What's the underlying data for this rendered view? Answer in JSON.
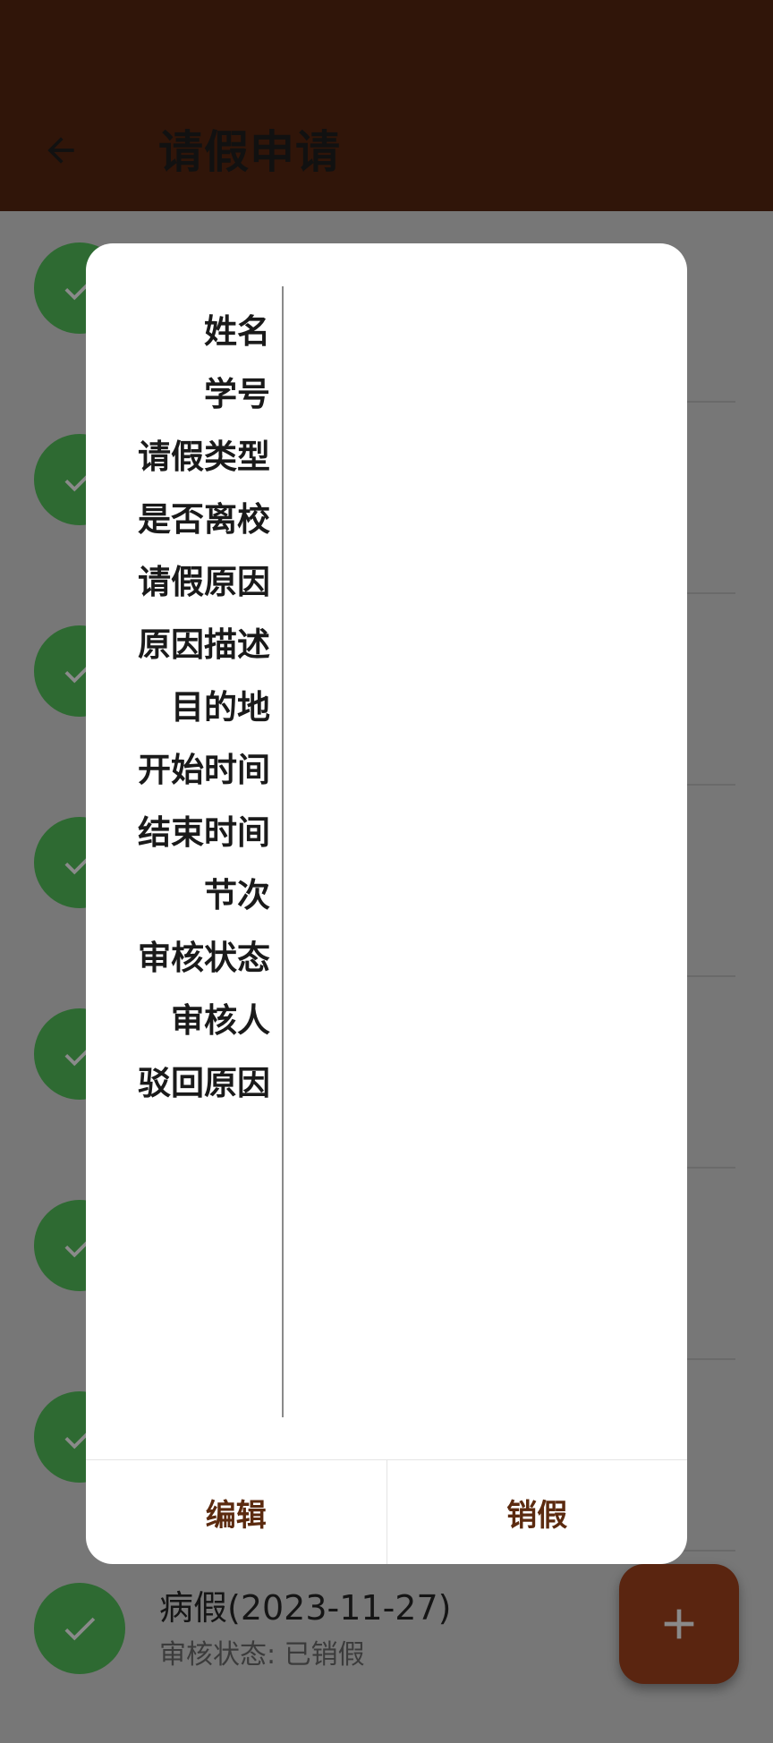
{
  "header": {
    "title": "请假申请",
    "back_icon": "arrow-left-icon"
  },
  "list": {
    "items": [
      {
        "title": "",
        "status": ""
      },
      {
        "title": "",
        "status": ""
      },
      {
        "title": "",
        "status": ""
      },
      {
        "title": "",
        "status": ""
      },
      {
        "title": "",
        "status": ""
      },
      {
        "title": "",
        "status": ""
      },
      {
        "title": "",
        "status": ""
      },
      {
        "title": "病假(2023-11-27)",
        "status": "审核状态: 已销假"
      }
    ]
  },
  "dialog": {
    "labels": [
      "姓名",
      "学号",
      "请假类型",
      "是否离校",
      "请假原因",
      "原因描述",
      "目的地",
      "开始时间",
      "结束时间",
      "节次",
      "审核状态",
      "审核人",
      "驳回原因"
    ],
    "edit_label": "编辑",
    "cancel_leave_label": "销假"
  },
  "fab": {
    "icon": "plus-icon"
  },
  "colors": {
    "header": "#301509",
    "check": "#2e6a32",
    "accent": "#5b2a0f",
    "fab": "#5a2510"
  }
}
